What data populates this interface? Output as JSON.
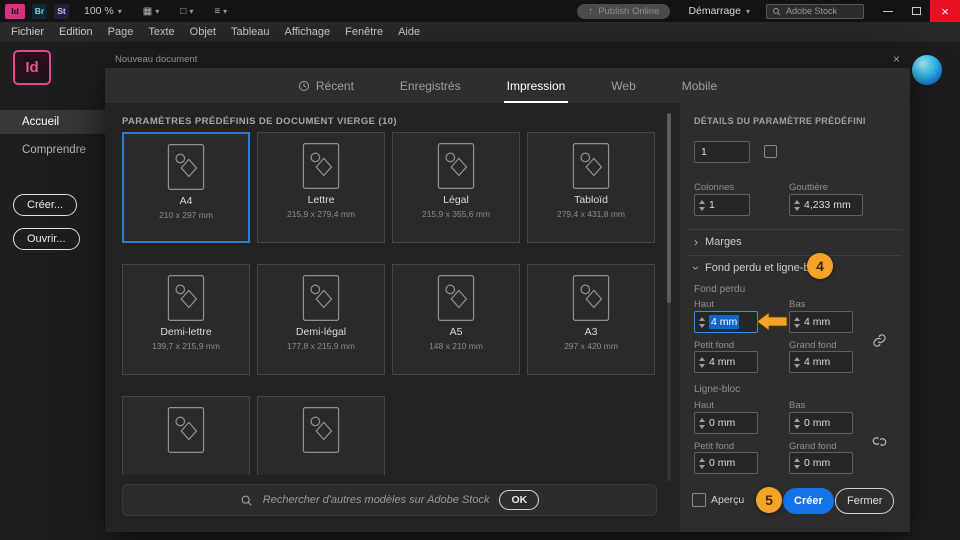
{
  "titlebar": {
    "id_badge": "Id",
    "br_badge": "Br",
    "st_badge": "St",
    "zoom": "100 %",
    "publish_online": "Publish Online",
    "demarrage": "Démarrage",
    "stock_search": "Adobe Stock"
  },
  "menubar": {
    "items": [
      "Fichier",
      "Edition",
      "Page",
      "Texte",
      "Objet",
      "Tableau",
      "Affichage",
      "Fenêtre",
      "Aide"
    ]
  },
  "sidebar": {
    "logo": "Id",
    "accueil": "Accueil",
    "comprendre": "Comprendre",
    "creer": "Créer...",
    "ouvrir": "Ouvrir..."
  },
  "dialog": {
    "title": "Nouveau document",
    "tabs": {
      "recent": "Récent",
      "enregistres": "Enregistrés",
      "impression": "Impression",
      "web": "Web",
      "mobile": "Mobile"
    },
    "presets_heading": "PARAMÈTRES PRÉDÉFINIS DE DOCUMENT VIERGE (10)",
    "presets": [
      {
        "name": "A4",
        "size": "210 x 297 mm"
      },
      {
        "name": "Lettre",
        "size": "215,9 x 279,4 mm"
      },
      {
        "name": "Légal",
        "size": "215,9 x 355,6 mm"
      },
      {
        "name": "Tabloïd",
        "size": "279,4 x 431,8 mm"
      },
      {
        "name": "Demi-lettre",
        "size": "139,7 x 215,9 mm"
      },
      {
        "name": "Demi-légal",
        "size": "177,8 x 215,9 mm"
      },
      {
        "name": "A5",
        "size": "148 x 210 mm"
      },
      {
        "name": "A3",
        "size": "297 x 420 mm"
      },
      {
        "name": "",
        "size": ""
      },
      {
        "name": "",
        "size": ""
      }
    ],
    "search_placeholder": "Rechercher d'autres modèles sur Adobe Stock",
    "search_ok": "OK"
  },
  "details": {
    "heading": "DÉTAILS DU PARAMÈTRE PRÉDÉFINI",
    "pages_value": "1",
    "colonnes": "Colonnes",
    "colonnes_value": "1",
    "gouttiere": "Gouttière",
    "gouttiere_value": "4,233 mm",
    "marges": "Marges",
    "fond_perdu_ligne_bloc": "Fond perdu et ligne-bloc",
    "fond_perdu": "Fond perdu",
    "ligne_bloc": "Ligne-bloc",
    "haut": "Haut",
    "bas": "Bas",
    "petit_fond": "Petit fond",
    "grand_fond": "Grand fond",
    "bleed": {
      "haut": "4 mm",
      "bas": "4 mm",
      "petit": "4 mm",
      "grand": "4 mm"
    },
    "slug": {
      "haut": "0 mm",
      "bas": "0 mm",
      "petit": "0 mm",
      "grand": "0 mm"
    },
    "apercu": "Aperçu",
    "creer": "Créer",
    "fermer": "Fermer"
  },
  "annotations": {
    "step4": "4",
    "step5": "5"
  },
  "icons": {
    "dropdown": "▾",
    "chevron": "›",
    "grid_tool": "▦",
    "frame_tool": "□",
    "panel_tool": "≡",
    "publish_arrow": "↑",
    "close": "×"
  },
  "colors": {
    "accent_blue": "#1473e6",
    "annotation_orange": "#f4a329",
    "selection_blue": "#2b7cd3"
  }
}
